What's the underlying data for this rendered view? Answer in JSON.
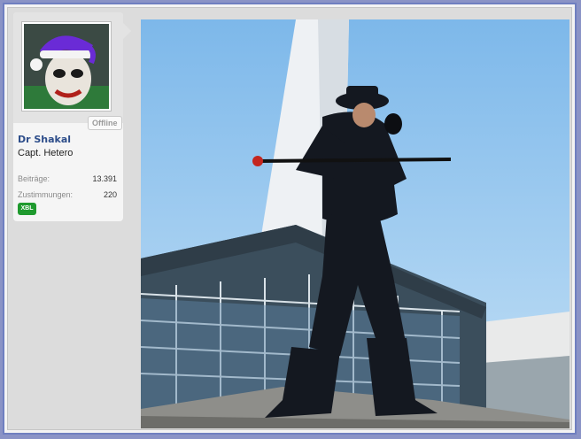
{
  "user": {
    "name": "Dr Shakal",
    "title": "Capt. Hetero",
    "status": "Offline",
    "stats": [
      {
        "label": "Beiträge:",
        "value": "13.391"
      },
      {
        "label": "Zustimmungen:",
        "value": "220"
      }
    ],
    "badge": "XBL",
    "avatar_icon": "joker-santa-avatar"
  },
  "post": {
    "image_icon": "photo-man-with-cane"
  },
  "colors": {
    "frame": "#6f7fc0",
    "username": "#2d4d8a",
    "badge": "#1f9a2e",
    "sky": "#9cc9ef"
  }
}
